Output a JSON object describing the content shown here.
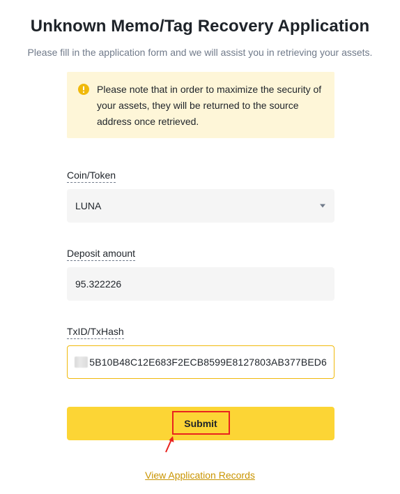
{
  "header": {
    "title": "Unknown Memo/Tag Recovery Application",
    "subtitle": "Please fill in the application form and we will assist you in retrieving your assets."
  },
  "notice": {
    "text": "Please note that in order to maximize the security of your assets, they will be returned to the source address once retrieved.",
    "icon": "warning-icon",
    "icon_color": "#f0b90b",
    "background": "#fef6d8"
  },
  "form": {
    "coin": {
      "label": "Coin/Token",
      "value": "LUNA"
    },
    "amount": {
      "label": "Deposit amount",
      "value": "95.322226"
    },
    "txid": {
      "label": "TxID/TxHash",
      "value": "5B10B48C12E683F2ECB8599E8127803AB377BED6",
      "accent": "#f0b90b"
    },
    "submit_label": "Submit"
  },
  "footer": {
    "records_link": "View Application Records"
  },
  "colors": {
    "brand_yellow": "#fcd535",
    "link": "#c99400",
    "annotation_red": "#e8231f"
  }
}
